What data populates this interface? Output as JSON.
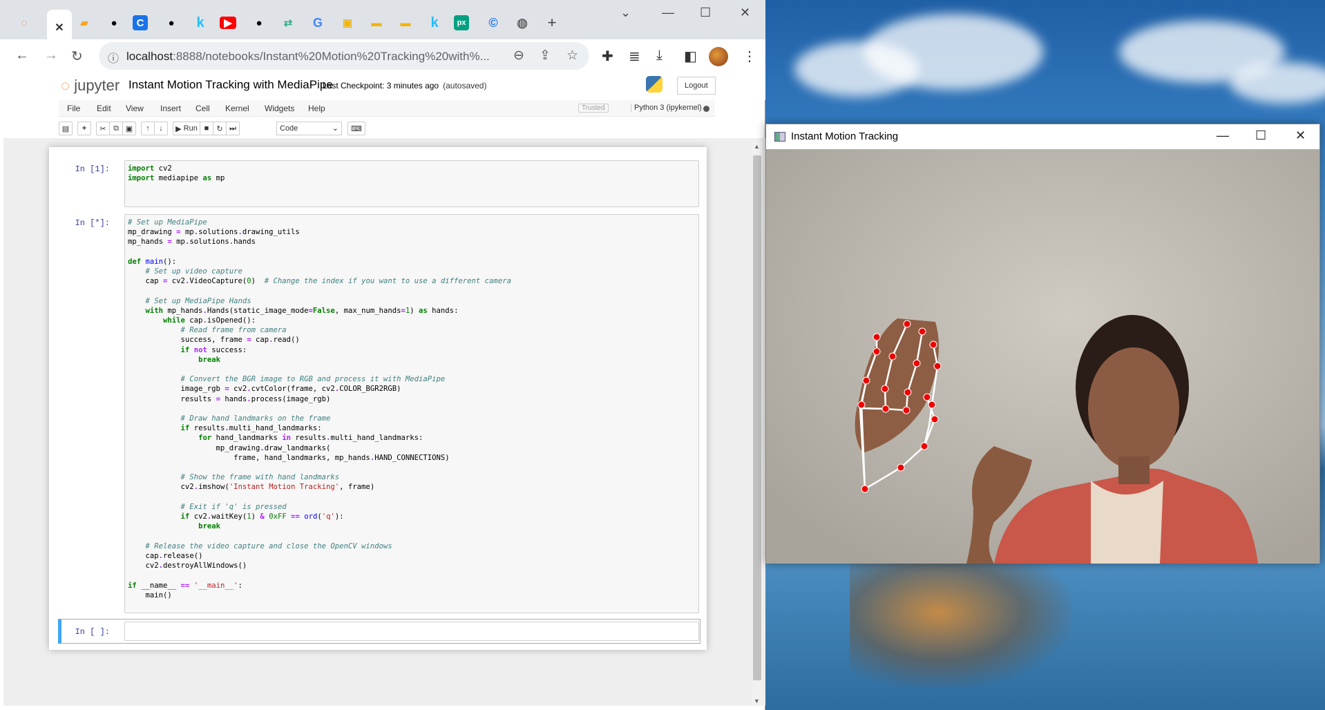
{
  "browser": {
    "url_host": "localhost",
    "url_path": ":8888/notebooks/Instant%20Motion%20Tracking%20with%...",
    "tabs": [
      "jupyter-tab",
      "close-icon",
      "notes",
      "github",
      "c-app",
      "github",
      "kaggle",
      "youtube",
      "github",
      "app",
      "google",
      "maps",
      "slides",
      "slides",
      "kaggle",
      "pixabay",
      "c-app",
      "globe"
    ],
    "new_tab": "+"
  },
  "jupyter": {
    "logo_text": "jupyter",
    "title": "Instant Motion Tracking with MediaPipe",
    "checkpoint": "Last Checkpoint: 3 minutes ago",
    "autosaved": "(autosaved)",
    "logout": "Logout",
    "menu": [
      "File",
      "Edit",
      "View",
      "Insert",
      "Cell",
      "Kernel",
      "Widgets",
      "Help"
    ],
    "trusted": "Trusted",
    "kernel": "Python 3 (ipykernel)",
    "run_label": "Run",
    "cell_type": "Code"
  },
  "cells": [
    {
      "prompt": "In [1]:"
    },
    {
      "prompt": "In [*]:"
    },
    {
      "prompt": "In [ ]:"
    }
  ],
  "opencv": {
    "title": "Instant Motion Tracking"
  }
}
